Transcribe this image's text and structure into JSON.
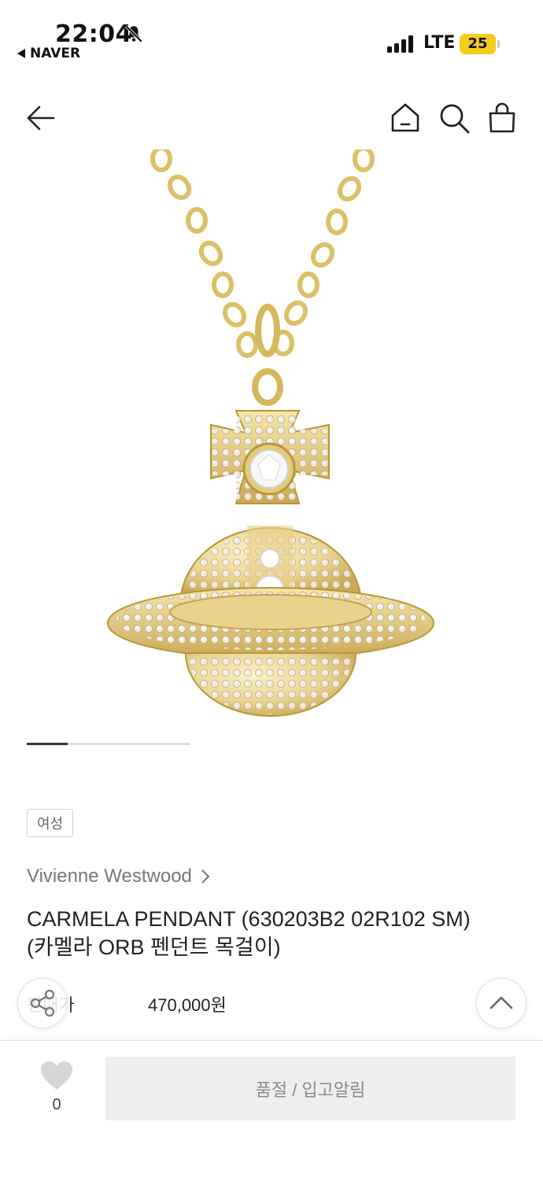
{
  "status_bar": {
    "time": "22:04",
    "back_app": "NAVER",
    "network": "LTE",
    "battery": "25"
  },
  "icons": {
    "back": "arrow-left-icon",
    "home": "home-icon",
    "search": "search-icon",
    "bag": "shopping-bag-icon",
    "heart": "heart-icon",
    "share": "share-icon",
    "scroll_top": "chevron-up-icon"
  },
  "gallery": {
    "progress_fraction": 0.25
  },
  "product": {
    "gender_tag": "여성",
    "brand": "Vivienne Westwood",
    "title_line1": "CARMELA PENDANT (630203B2 02R102 SM)",
    "title_line2": "(카멜라 ORB 펜던트 목걸이)",
    "price_label": "판매가",
    "price": "470,000원"
  },
  "bottom_bar": {
    "like_count": "0",
    "restock_label": "품절 / 입고알림"
  },
  "colors": {
    "gold": "#e2c66a",
    "gold_dark": "#b8963a",
    "button_bg": "#eeeeee",
    "battery": "#f4cc1a"
  }
}
